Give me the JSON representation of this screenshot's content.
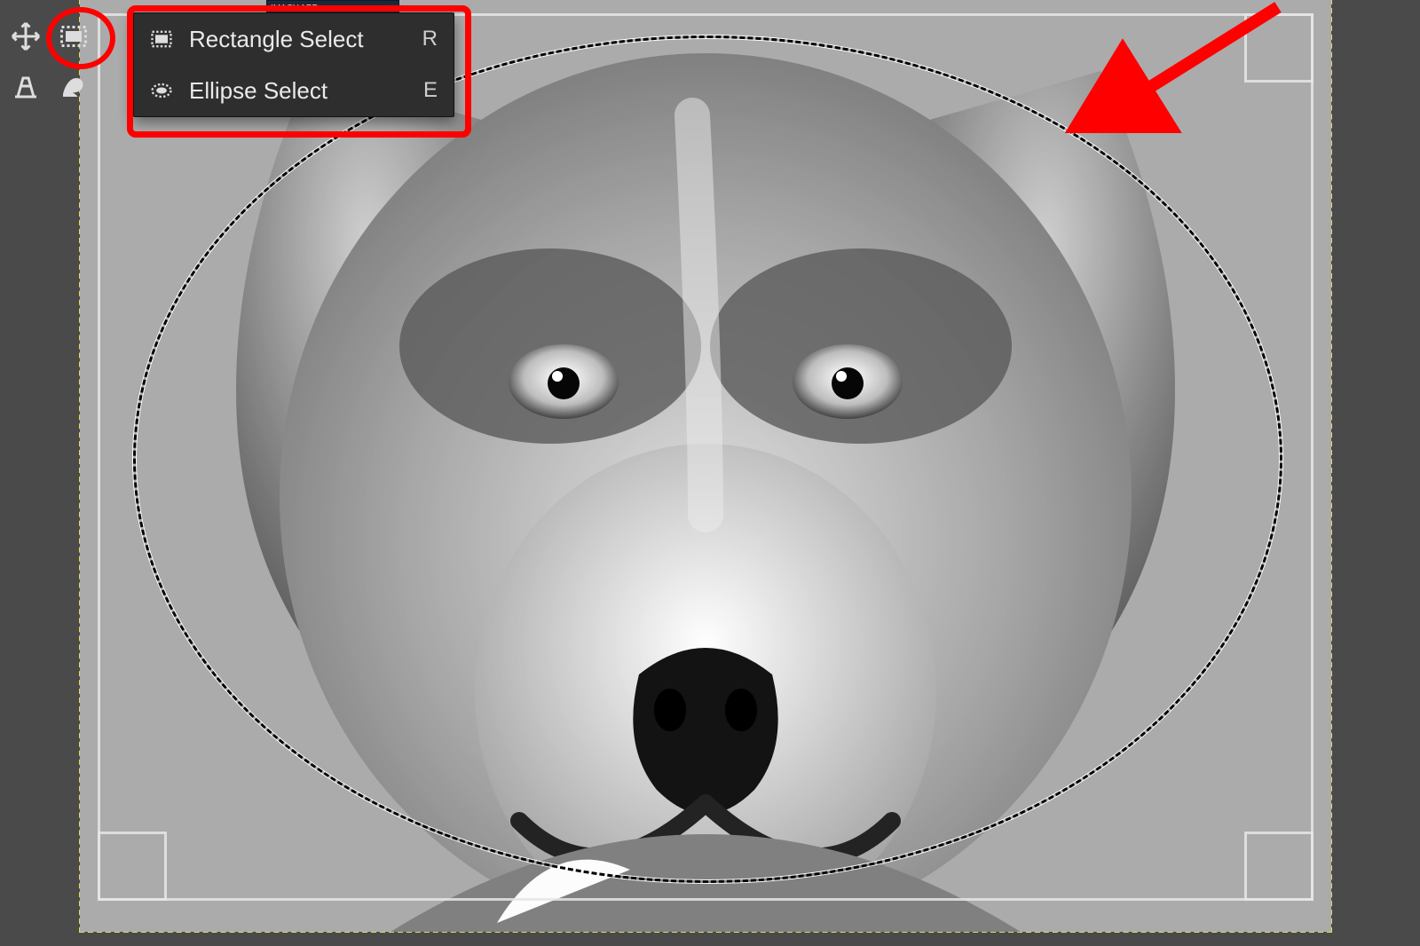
{
  "tab": {
    "title": "IMACY.APP",
    "close": "✕"
  },
  "toolbox": {
    "tools": [
      {
        "name": "move-tool"
      },
      {
        "name": "rectangle-select-tool"
      },
      {
        "name": "perspective-tool"
      },
      {
        "name": "warp-tool"
      }
    ]
  },
  "context_menu": {
    "items": [
      {
        "icon": "rectangle-select-icon",
        "label": "Rectangle Select",
        "shortcut": "R"
      },
      {
        "icon": "ellipse-select-icon",
        "label": "Ellipse Select",
        "shortcut": "E"
      }
    ]
  },
  "annotations": {
    "highlight_tool": "rectangle-select-tool",
    "arrow_target": "ellipse-selection-marquee"
  },
  "canvas": {
    "image_description": "Grayscale portrait of a dog on an olive-green background",
    "active_selection": "ellipse",
    "bounding_box_visible": true
  }
}
